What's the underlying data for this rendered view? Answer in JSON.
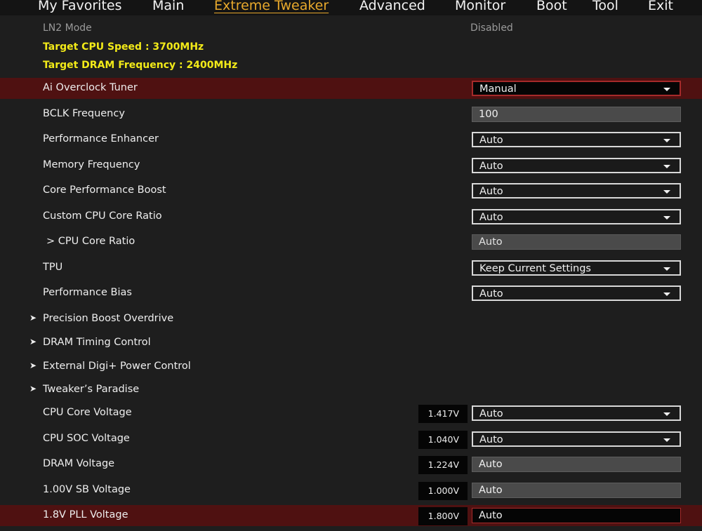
{
  "nav": {
    "tabs": [
      {
        "label": "My Favorites"
      },
      {
        "label": "Main"
      },
      {
        "label": "Extreme Tweaker"
      },
      {
        "label": "Advanced"
      },
      {
        "label": "Monitor"
      },
      {
        "label": "Boot"
      },
      {
        "label": "Tool"
      },
      {
        "label": "Exit"
      }
    ],
    "active_tab": "Extreme Tweaker"
  },
  "info": {
    "ln2_mode_label": "LN2 Mode",
    "ln2_mode_value": "Disabled",
    "target_cpu_speed": "Target CPU Speed : 3700MHz",
    "target_dram_frequency": "Target DRAM Frequency : 2400MHz"
  },
  "settings": [
    {
      "label": "Ai Overclock Tuner",
      "value": "Manual"
    },
    {
      "label": "BCLK Frequency",
      "value": "100"
    },
    {
      "label": "Performance Enhancer",
      "value": "Auto"
    },
    {
      "label": "Memory Frequency",
      "value": "Auto"
    },
    {
      "label": "Core Performance Boost",
      "value": "Auto"
    },
    {
      "label": "Custom CPU Core Ratio",
      "value": "Auto"
    },
    {
      "label": "> CPU Core Ratio",
      "value": "Auto"
    },
    {
      "label": "TPU",
      "value": "Keep Current Settings"
    },
    {
      "label": "Performance Bias",
      "value": "Auto"
    }
  ],
  "submenus": [
    {
      "label": "Precision Boost Overdrive"
    },
    {
      "label": "DRAM Timing Control"
    },
    {
      "label": "External Digi+ Power Control"
    },
    {
      "label": "Tweaker’s Paradise"
    }
  ],
  "voltages": [
    {
      "label": "CPU Core Voltage",
      "reading": "1.417V",
      "value": "Auto"
    },
    {
      "label": "CPU SOC Voltage",
      "reading": "1.040V",
      "value": "Auto"
    },
    {
      "label": "DRAM Voltage",
      "reading": "1.224V",
      "value": "Auto"
    },
    {
      "label": "1.00V SB Voltage",
      "reading": "1.000V",
      "value": "Auto"
    },
    {
      "label": "1.8V PLL Voltage",
      "reading": "1.800V",
      "value": "Auto"
    }
  ],
  "colors": {
    "active_tab": "#e8a92c",
    "highlight_row": "#4f1111",
    "target_text": "#f2ea18"
  }
}
